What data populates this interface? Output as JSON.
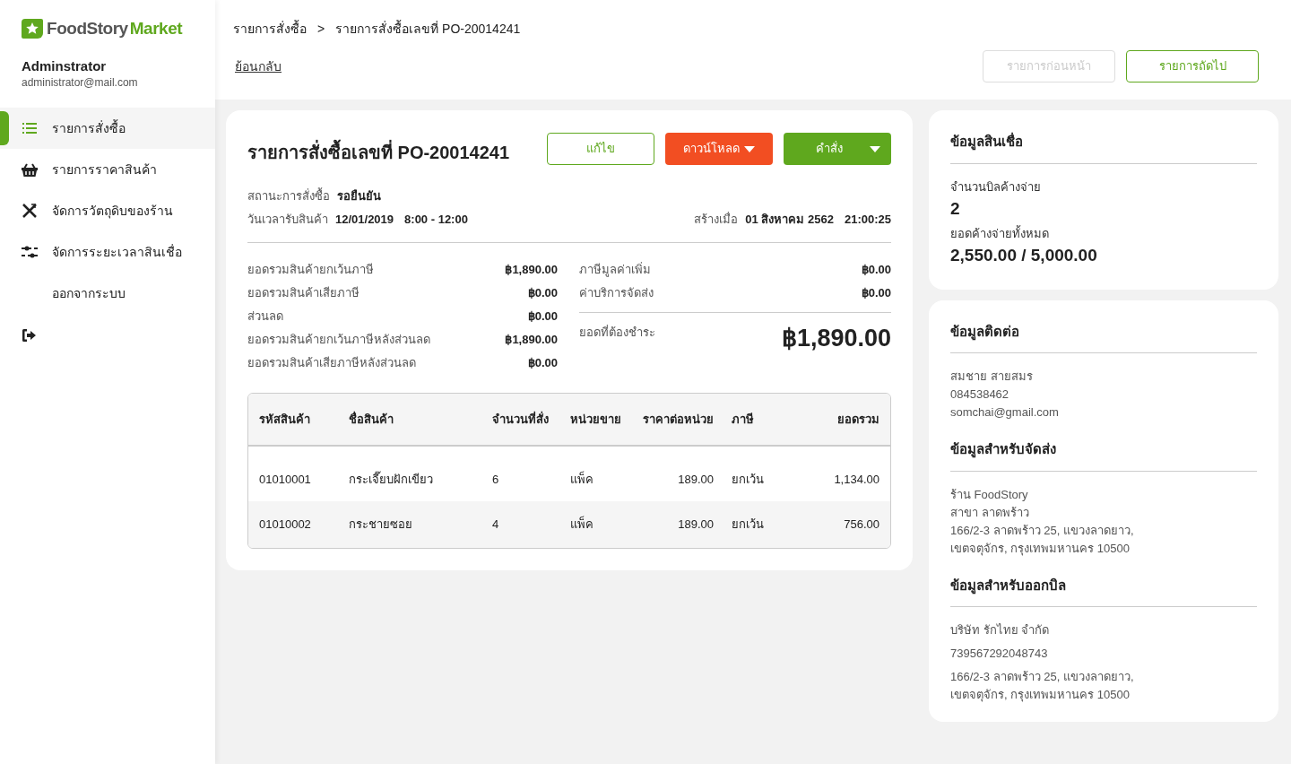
{
  "logo": {
    "name": "FoodStory",
    "accent": "Market"
  },
  "user": {
    "name": "Adminstrator",
    "email": "administrator@mail.com"
  },
  "nav": [
    {
      "label": "รายการสั่งซื้อ",
      "selected": true
    },
    {
      "label": "รายการราคาสินค้า",
      "selected": false
    },
    {
      "label": "จัดการวัตถุดิบของร้าน",
      "selected": false
    },
    {
      "label": "จัดการระยะเวลาสินเชื่อ",
      "selected": false
    },
    {
      "label": "ออกจากระบบ",
      "selected": false
    }
  ],
  "breadcrumb": [
    "รายการสั่งซื้อ",
    ">",
    "รายการสั่งซื้อเลขที่ PO-20014241"
  ],
  "back_link": "ย้อนกลับ",
  "pager": [
    {
      "label": "รายการก่อนหน้า",
      "disabled": true
    },
    {
      "label": "รายการถัดไป",
      "disabled": false
    }
  ],
  "order": {
    "title": "รายการสั่งซื้อเลขที่ PO-20014241",
    "buttons": [
      {
        "label": "แก้ไข",
        "kind": "outline",
        "dropdown": false
      },
      {
        "label": "ดาวน์โหลด",
        "kind": "orange",
        "dropdown": true
      },
      {
        "label": "คำสั่ง",
        "kind": "green",
        "dropdown": true
      }
    ],
    "status": {
      "label": "สถานะการสั่งซื้อ",
      "value": "รอยืนยัน"
    },
    "delivery": {
      "label": "วันเวลารับสินค้า",
      "date": "12/01/2019",
      "time": "8:00 - 12:00"
    },
    "created": {
      "label": "สร้างเมื่อ",
      "date": "01 สิงหาคม 2562",
      "time": "21:00:25"
    },
    "summary_left": [
      {
        "label": "ยอดรวมสินค้ายกเว้นภาษี",
        "value": "฿1,890.00"
      },
      {
        "label": "ยอดรวมสินค้าเสียภาษี",
        "value": "฿0.00"
      },
      {
        "label": "ส่วนลด",
        "value": "฿0.00"
      },
      {
        "label": "ยอดรวมสินค้ายกเว้นภาษีหลังส่วนลด",
        "value": "฿1,890.00"
      },
      {
        "label": "ยอดรวมสินค้าเสียภาษีหลังส่วนลด",
        "value": "฿0.00"
      }
    ],
    "summary_right": [
      {
        "label": "ภาษีมูลค่าเพิ่ม",
        "value": "฿0.00"
      },
      {
        "label": "ค่าบริการจัดส่ง",
        "value": "฿0.00"
      }
    ],
    "total": {
      "label": "ยอดที่ต้องชำระ",
      "value": "฿1,890.00"
    }
  },
  "table": {
    "columns": [
      "รหัสสินค้า",
      "ชื่อสินค้า",
      "จำนวนที่สั่ง",
      "หน่วยขาย",
      "ราคาต่อหน่วย",
      "ภาษี",
      "ยอดรวม"
    ],
    "rows": [
      [
        "01010001",
        "กระเจี๊ยบฝักเขียว",
        "6",
        "แพ็ค",
        "189.00",
        "ยกเว้น",
        "1,134.00"
      ],
      [
        "01010002",
        "กระชายซอย",
        "4",
        "แพ็ค",
        "189.00",
        "ยกเว้น",
        "756.00"
      ]
    ]
  },
  "credit": {
    "title": "ข้อมูลสินเชื่อ",
    "items": [
      {
        "label": "จำนวนบิลค้างจ่าย",
        "value": "2"
      },
      {
        "label": "ยอดค้างจ่ายทั้งหมด",
        "value": "2,550.00 / 5,000.00"
      }
    ]
  },
  "info_sections": [
    {
      "title": "ข้อมูลติดต่อ",
      "blocks": [
        [
          "สมชาย สายสมร",
          "084538462",
          "somchai@gmail.com"
        ]
      ]
    },
    {
      "title": "ข้อมูลสำหรับจัดส่ง",
      "blocks": [
        [
          "ร้าน FoodStory",
          "สาขา ลาดพร้าว",
          "166/2-3 ลาดพร้าว 25, แขวงลาดยาว,",
          "เขตจตุจักร, กรุงเทพมหานคร 10500"
        ]
      ]
    },
    {
      "title": "ข้อมูลสำหรับออกบิล",
      "blocks": [
        [
          "บริษัท รักไทย จำกัด"
        ],
        [
          "739567292048743"
        ],
        [
          "166/2-3 ลาดพร้าว 25, แขวงลาดยาว,",
          "เขตจตุจักร, กรุงเทพมหานคร 10500"
        ]
      ]
    }
  ]
}
